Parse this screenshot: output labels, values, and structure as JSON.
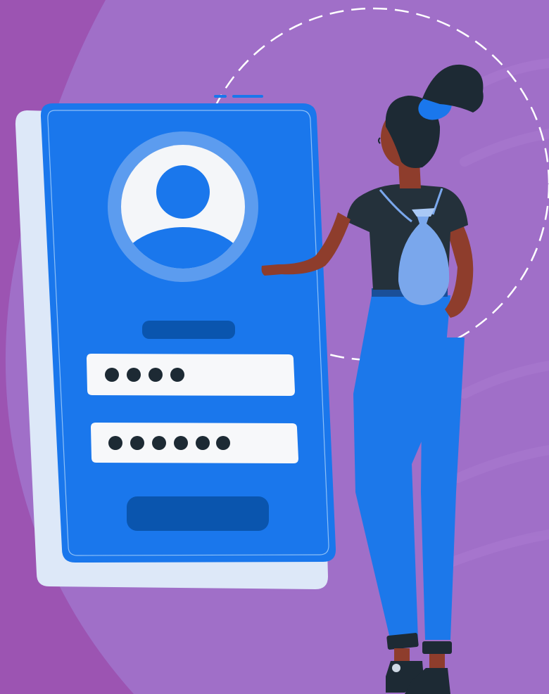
{
  "illustration": {
    "login_screen": {
      "username_dots": 4,
      "password_dots": 6
    }
  },
  "colors": {
    "background_outer": "#9c54b2",
    "background_blob": "#a06fc8",
    "phone_blue": "#1a77ec",
    "phone_shadow": "#dde8f8",
    "dark_blue": "#0a55ae",
    "avatar_ring": "#5c9cef",
    "input_white": "#f7f8fa",
    "skin": "#8e3d2c",
    "hair": "#1d2a34",
    "shirt": "#24313b",
    "backpack": "#7aa7ec",
    "pants": "#1c78ea"
  }
}
